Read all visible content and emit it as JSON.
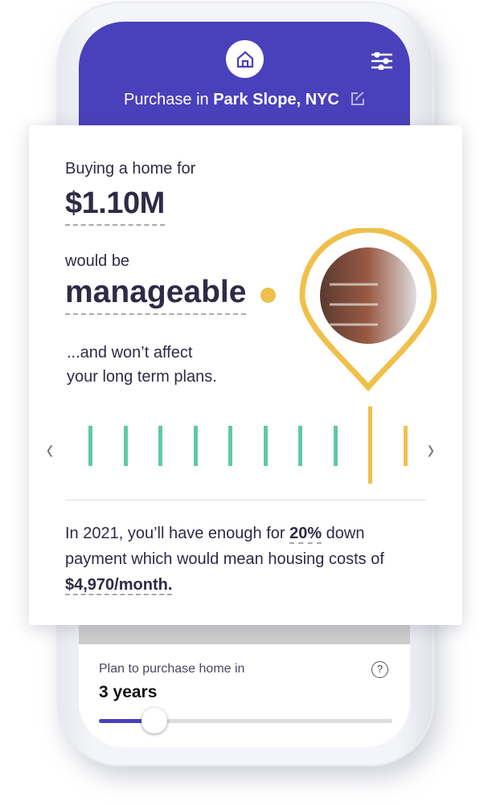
{
  "header": {
    "title_prefix": "Purchase in ",
    "location": "Park Slope, NYC",
    "icons": [
      "home-icon",
      "sliders-icon",
      "edit-icon"
    ]
  },
  "card": {
    "line1": "Buying a home for",
    "price": "$1.10M",
    "line2": "would be",
    "verdict": "manageable",
    "line3a": "...and won’t affect",
    "line3b": "your long term plans.",
    "ticks": [
      {
        "color": "#5ec9a8",
        "tall": false
      },
      {
        "color": "#5ec9a8",
        "tall": false
      },
      {
        "color": "#5ec9a8",
        "tall": false
      },
      {
        "color": "#5ec9a8",
        "tall": false
      },
      {
        "color": "#5ec9a8",
        "tall": false
      },
      {
        "color": "#5ec9a8",
        "tall": false
      },
      {
        "color": "#5ec9a8",
        "tall": false
      },
      {
        "color": "#5ec9a8",
        "tall": false
      },
      {
        "color": "#efc04a",
        "tall": true
      },
      {
        "color": "#efc04a",
        "tall": false
      }
    ],
    "prev": "‹",
    "next": "›",
    "summary": {
      "a": "In 2021, you’ll have enough for ",
      "pct": "20%",
      "b": " down payment which would mean housing costs of ",
      "cost": "$4,970/month."
    }
  },
  "plan": {
    "label": "Plan to purchase home in",
    "value": "3 years",
    "help": "?",
    "slider_fraction": 0.19
  },
  "colors": {
    "brand": "#4940bb",
    "accent": "#efc04a",
    "good": "#5ec9a8"
  }
}
